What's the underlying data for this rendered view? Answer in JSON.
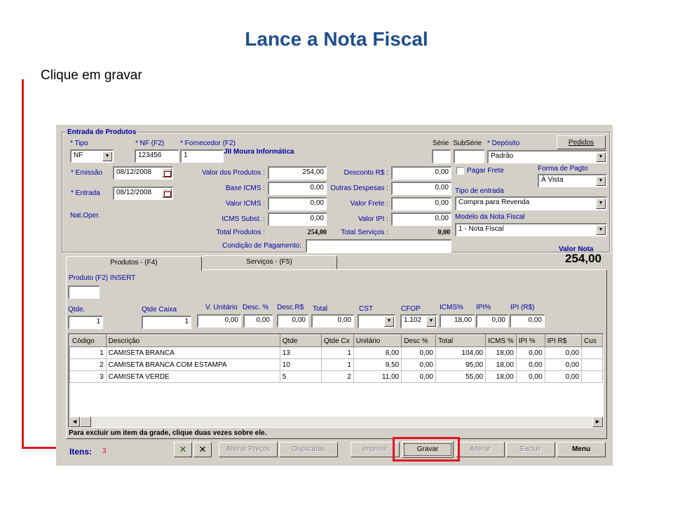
{
  "slide": {
    "title": "Lance a Nota Fiscal",
    "instruction": "Clique em gravar"
  },
  "colors": {
    "title": "#1F4E8C",
    "highlight": "#E0141E",
    "window": "#D4D0C8"
  },
  "header": {
    "group_title": "Entrada de Produtos",
    "pedidos_label": "Pedidos",
    "tipo_label": "* Tipo",
    "tipo_value": "NF",
    "nf_label": "* NF (F2)",
    "nf_value": "123456",
    "fornecedor_label": "* Fornecedor (F2)",
    "fornecedor_value": "1",
    "fornecedor_name": "JII Moura Informática",
    "serie_label": "Série",
    "subserie_label": "SubSérie",
    "deposito_label": "* Depósito",
    "deposito_value": "Padrão",
    "emissao_label": "* Emissão",
    "emissao_value": "08/12/2008",
    "entrada_label": "* Entrada",
    "entrada_value": "08/12/2008",
    "natoper_label": "Nat.Oper.",
    "valor_produtos_label": "Valor dos Produtos :",
    "valor_produtos": "254,00",
    "base_icms_label": "Base ICMS :",
    "base_icms": "0,00",
    "valor_icms_label": "Valor ICMS :",
    "valor_icms": "0,00",
    "icms_subst_label": "ICMS Subst. :",
    "icms_subst": "0,00",
    "total_produtos_label": "Total Produtos :",
    "total_produtos": "254,00",
    "desconto_label": "Desconto R$ :",
    "desconto": "0,00",
    "outras_label": "Outras Despesas :",
    "outras": "0,00",
    "frete_label": "Valor Frete :",
    "frete": "0,00",
    "ipi_label": "Valor IPI :",
    "ipi": "0,00",
    "total_servicos_label": "Total Serviços :",
    "total_servicos": "0,00",
    "condicao_label": "Condição de Pagamento:",
    "pagar_frete_label": "Pagar Frete",
    "forma_pagto_label": "Forma de Pagto",
    "forma_pagto_value": "À Vista",
    "tipo_entrada_label": "Tipo de entrada",
    "tipo_entrada_value": "Compra para Revenda",
    "modelo_label": "Modelo da Nota Fiscal",
    "modelo_value": "1 - Nota Fiscal",
    "valor_nota_label": "Valor Nota",
    "valor_nota": "254,00"
  },
  "tabs": [
    {
      "label": "Produtos  - (F4)"
    },
    {
      "label": "Serviços  - (F5)"
    }
  ],
  "produto": {
    "produto_label": "Produto (F2)  INSERT",
    "qtde_label": "Qtde.",
    "qtde": "1",
    "qtde_caixa_label": "Qtde Caixa",
    "qtde_caixa": "1",
    "vunit_label": "V. Unitário",
    "vunit": "0,00",
    "desc_pct_label": "Desc. %",
    "desc_pct": "0,00",
    "desc_rs_label": "Desc.R$",
    "desc_rs": "0,00",
    "total_label": "Total",
    "total": "0,00",
    "cst_label": "CST",
    "cst": "",
    "cfop_label": "CFOP",
    "cfop": "1.102",
    "icms_pct_label": "ICMS%",
    "icms_pct": "18,00",
    "ipi_pct_label": "IPI%",
    "ipi_pct": "0,00",
    "ipi_rs_label": "IPI (R$)",
    "ipi_rs": "0,00"
  },
  "grid": {
    "columns": [
      "Código",
      "Descrição",
      "Qtde",
      "Qtde Cx",
      "Unitário",
      "Desc %",
      "Total",
      "ICMS %",
      "IPI %",
      "IPI R$",
      "Cus"
    ],
    "rows": [
      [
        "1",
        "CAMISETA BRANCA",
        "13",
        "1",
        "8,00",
        "0,00",
        "104,00",
        "18,00",
        "0,00",
        "0,00",
        ""
      ],
      [
        "2",
        "CAMISETA BRANCA COM ESTAMPA",
        "10",
        "1",
        "9,50",
        "0,00",
        "95,00",
        "18,00",
        "0,00",
        "0,00",
        ""
      ],
      [
        "3",
        "CAMISETA VERDE",
        "5",
        "2",
        "11,00",
        "0,00",
        "55,00",
        "18,00",
        "0,00",
        "0,00",
        ""
      ]
    ],
    "hint": "Para excluir um item da grade, clique duas vezes sobre ele."
  },
  "footer": {
    "itens_label": "Itens:",
    "itens_count": "3",
    "alterar_precos": "Alterar Preços",
    "duplicatas": "Duplicatas",
    "imprimir": "Imprimir",
    "gravar": "Gravar",
    "alterar": "Alterar",
    "excluir": "Excluir",
    "menu": "Menu"
  }
}
